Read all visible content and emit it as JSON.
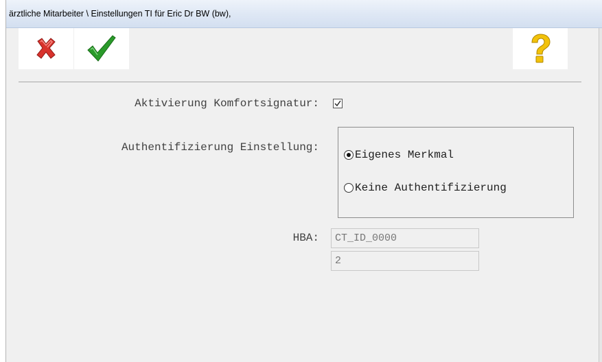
{
  "window": {
    "title": "ärztliche Mitarbeiter \\ Einstellungen TI für Eric Dr BW (bw),"
  },
  "toolbar": {
    "cancel_icon": "red-x-icon",
    "ok_icon": "green-check-icon",
    "help_icon": "question-mark-icon",
    "colors": {
      "cancel": "#d8322c",
      "ok": "#2a9a2a",
      "help": "#f2c20a"
    }
  },
  "form": {
    "komfort": {
      "label": "Aktivierung Komfortsignatur:",
      "checked": true
    },
    "auth": {
      "label": "Authentifizierung Einstellung:",
      "options": [
        {
          "label": "Eigenes Merkmal",
          "selected": true
        },
        {
          "label": "Keine Authentifizierung",
          "selected": false
        }
      ]
    },
    "hba": {
      "label": "HBA:",
      "field1": "CT_ID_0000",
      "field2": "2"
    }
  }
}
